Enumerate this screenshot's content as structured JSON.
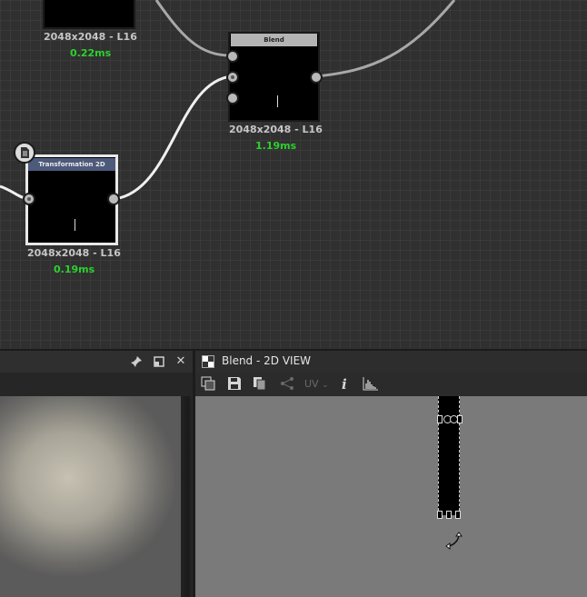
{
  "graph": {
    "nodes": [
      {
        "id": "top",
        "title": "",
        "resolution": "2048x2048 - L16",
        "time": "0.22ms"
      },
      {
        "id": "blend",
        "title": "Blend",
        "resolution": "2048x2048 - L16",
        "time": "1.19ms"
      },
      {
        "id": "transform",
        "title": "Transformation 2D",
        "resolution": "2048x2048 - L16",
        "time": "0.19ms"
      }
    ],
    "colors": {
      "time": "#2cd12c",
      "blend_title_bg": "#b4b4b4",
      "transform_title_bg": "#4d5a7c"
    }
  },
  "left_panel": {
    "icons": [
      "pin-icon",
      "restore-window-icon",
      "close-icon"
    ],
    "close_glyph": "✕"
  },
  "view_panel": {
    "title": "Blend - 2D VIEW",
    "toolbar": {
      "uv_label": "UV",
      "info_label": "i"
    }
  }
}
